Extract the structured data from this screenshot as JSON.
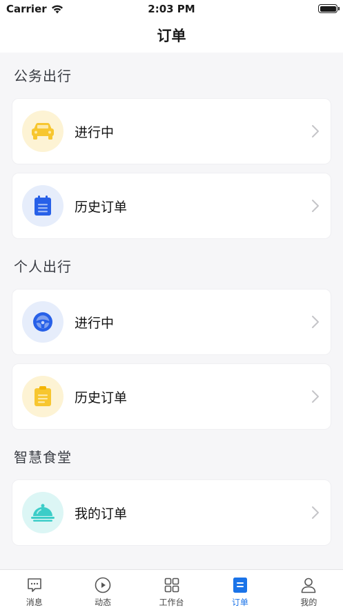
{
  "status_bar": {
    "carrier": "Carrier",
    "time": "2:03 PM"
  },
  "header": {
    "title": "订单"
  },
  "sections": [
    {
      "title": "公务出行",
      "items": [
        {
          "label": "进行中",
          "icon": "car-icon",
          "color": "#f7c62f"
        },
        {
          "label": "历史订单",
          "icon": "notepad-icon",
          "color": "#2760e8"
        }
      ]
    },
    {
      "title": "个人出行",
      "items": [
        {
          "label": "进行中",
          "icon": "steering-wheel-icon",
          "color": "#2760e8"
        },
        {
          "label": "历史订单",
          "icon": "notepad-icon",
          "color": "#f7c62f"
        }
      ]
    },
    {
      "title": "智慧食堂",
      "items": [
        {
          "label": "我的订单",
          "icon": "food-cloche-icon",
          "color": "#3ccdc8"
        }
      ]
    }
  ],
  "tab_bar": {
    "tabs": [
      {
        "label": "消息",
        "icon": "message-icon"
      },
      {
        "label": "动态",
        "icon": "play-icon"
      },
      {
        "label": "工作台",
        "icon": "grid-icon"
      },
      {
        "label": "订单",
        "icon": "order-icon",
        "active": true
      },
      {
        "label": "我的",
        "icon": "person-icon"
      }
    ],
    "active_color": "#1a73e8"
  }
}
